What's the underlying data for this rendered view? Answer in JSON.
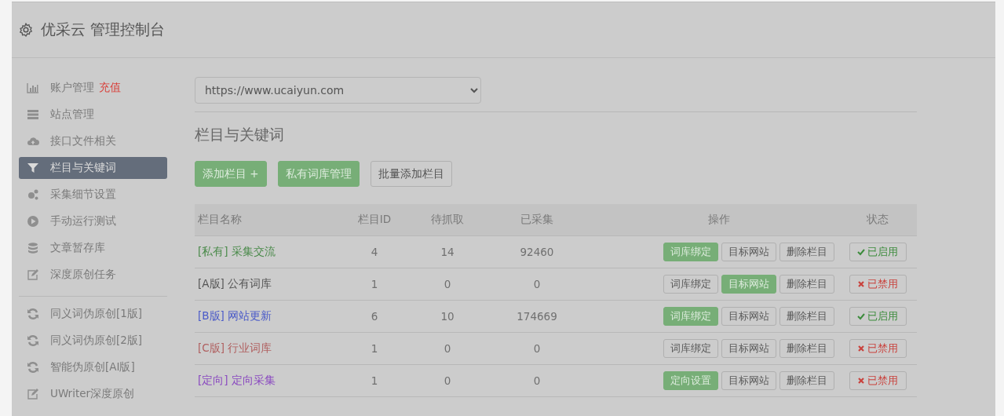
{
  "header": {
    "title": "优采云 管理控制台"
  },
  "sidebar": {
    "items": [
      {
        "label": "账户管理",
        "badge": "充值",
        "selected": false
      },
      {
        "label": "站点管理",
        "selected": false
      },
      {
        "label": "接口文件相关",
        "selected": false
      },
      {
        "label": "栏目与关键词",
        "selected": true
      },
      {
        "label": "采集细节设置",
        "selected": false
      },
      {
        "label": "手动运行测试",
        "selected": false
      },
      {
        "label": "文章暂存库",
        "selected": false
      },
      {
        "label": "深度原创任务",
        "selected": false
      }
    ],
    "items_2": [
      {
        "label": "同义词伪原创[1版]",
        "selected": false
      },
      {
        "label": "同义词伪原创[2版]",
        "selected": false
      },
      {
        "label": "智能伪原创[AI版]",
        "selected": false
      },
      {
        "label": "UWriter深度原创",
        "selected": false
      }
    ]
  },
  "site_select": {
    "value": "https://www.ucaiyun.com"
  },
  "section_title": "栏目与关键词",
  "toolbar": [
    {
      "label": "添加栏目 +",
      "primary": true
    },
    {
      "label": "私有词库管理",
      "primary": true
    },
    {
      "label": "批量添加栏目",
      "primary": false
    }
  ],
  "table": {
    "columns": [
      "栏目名称",
      "栏目ID",
      "待抓取",
      "已采集",
      "操作",
      "状态"
    ],
    "rows": [
      {
        "tag": "[私有]",
        "name": "采集交流",
        "color": "#4a8a4a",
        "id": "4",
        "pending": "14",
        "collected": "92460",
        "actions": [
          {
            "label": "词库绑定",
            "primary": true
          },
          {
            "label": "目标网站",
            "primary": false
          },
          {
            "label": "删除栏目",
            "primary": false
          }
        ],
        "enabled": true,
        "status": "已启用"
      },
      {
        "tag": "[A版]",
        "name": "公有词库",
        "color": "#555555",
        "id": "1",
        "pending": "0",
        "collected": "0",
        "actions": [
          {
            "label": "词库绑定",
            "primary": false
          },
          {
            "label": "目标网站",
            "primary": true
          },
          {
            "label": "删除栏目",
            "primary": false
          }
        ],
        "enabled": false,
        "status": "已禁用"
      },
      {
        "tag": "[B版]",
        "name": "网站更新",
        "color": "#4a5ac8",
        "id": "6",
        "pending": "10",
        "collected": "174669",
        "actions": [
          {
            "label": "词库绑定",
            "primary": true
          },
          {
            "label": "目标网站",
            "primary": false
          },
          {
            "label": "删除栏目",
            "primary": false
          }
        ],
        "enabled": true,
        "status": "已启用"
      },
      {
        "tag": "[C版]",
        "name": "行业词库",
        "color": "#b06060",
        "id": "1",
        "pending": "0",
        "collected": "0",
        "actions": [
          {
            "label": "词库绑定",
            "primary": false
          },
          {
            "label": "目标网站",
            "primary": false
          },
          {
            "label": "删除栏目",
            "primary": false
          }
        ],
        "enabled": false,
        "status": "已禁用"
      },
      {
        "tag": "[定向]",
        "name": "定向采集",
        "color": "#8a4ac0",
        "id": "1",
        "pending": "0",
        "collected": "0",
        "actions": [
          {
            "label": "定向设置",
            "primary": true
          },
          {
            "label": "目标网站",
            "primary": false
          },
          {
            "label": "删除栏目",
            "primary": false
          }
        ],
        "enabled": false,
        "status": "已禁用"
      }
    ]
  }
}
